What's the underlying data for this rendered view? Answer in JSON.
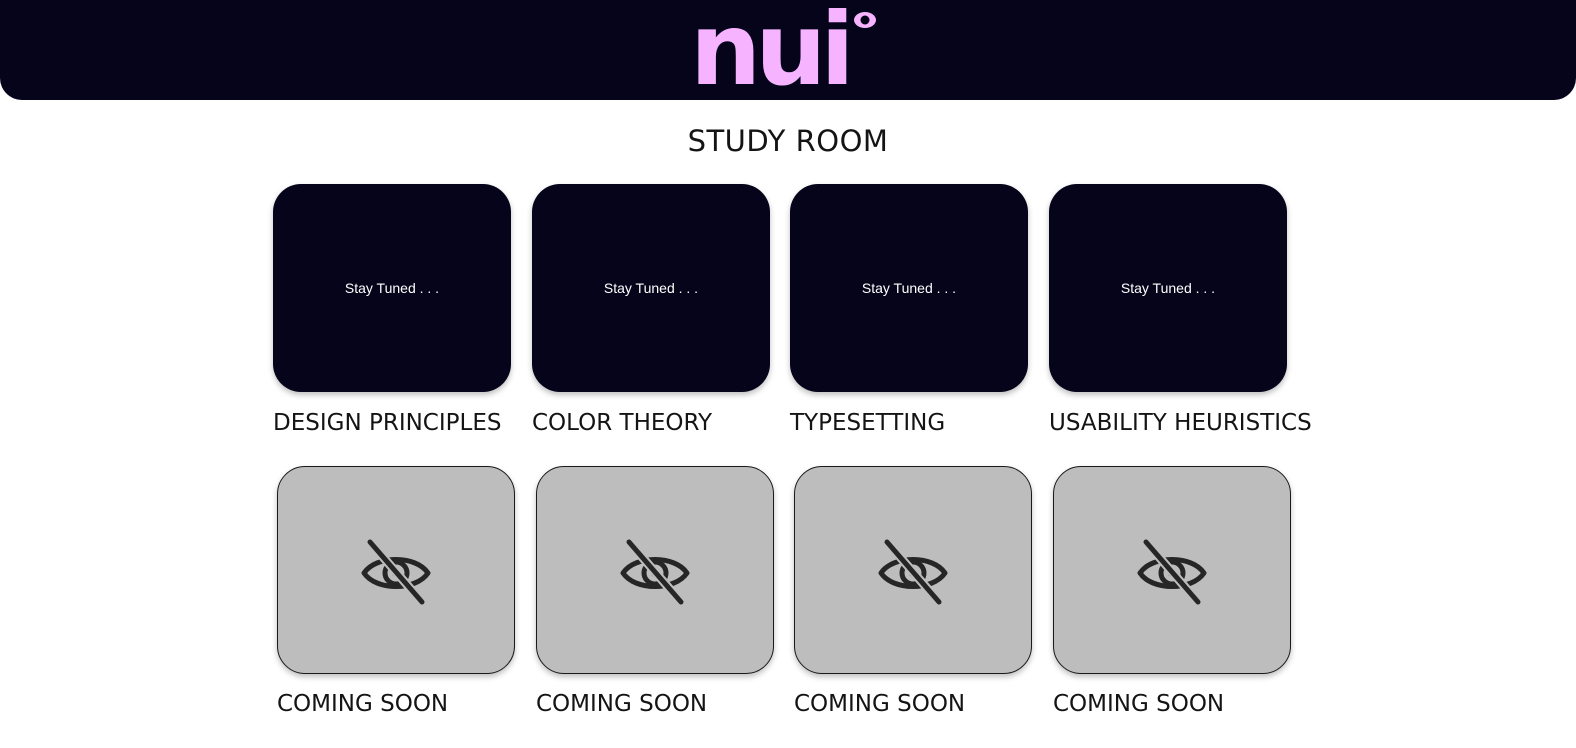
{
  "header": {
    "logo_text": "nui",
    "bg_color": "#06041a",
    "logo_color": "#f6b3ff"
  },
  "main": {
    "title": "STUDY ROOM",
    "topics": [
      {
        "card_text": "Stay Tuned . . .",
        "caption": "DESIGN PRINCIPLES"
      },
      {
        "card_text": "Stay Tuned . . .",
        "caption": "COLOR THEORY"
      },
      {
        "card_text": "Stay Tuned . . .",
        "caption": "TYPESETTING"
      },
      {
        "card_text": "Stay Tuned . . .",
        "caption": "USABILITY HEURISTICS"
      }
    ],
    "locked": [
      {
        "icon": "eye-off-icon",
        "caption": "COMING SOON"
      },
      {
        "icon": "eye-off-icon",
        "caption": "COMING SOON"
      },
      {
        "icon": "eye-off-icon",
        "caption": "COMING SOON"
      },
      {
        "icon": "eye-off-icon",
        "caption": "COMING SOON"
      }
    ]
  }
}
